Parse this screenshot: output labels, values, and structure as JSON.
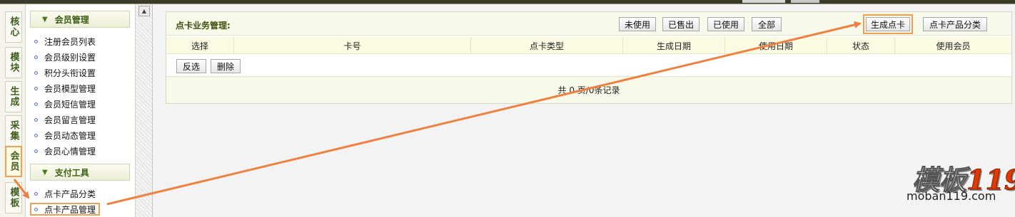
{
  "tabs": [
    {
      "label": "核心",
      "active": false
    },
    {
      "label": "模块",
      "active": false
    },
    {
      "label": "生成",
      "active": false
    },
    {
      "label": "采集",
      "active": false
    },
    {
      "label": "会员",
      "active": true
    },
    {
      "label": "模板",
      "active": false
    }
  ],
  "sidebar": {
    "sections": [
      {
        "title": "会员管理",
        "items": [
          "注册会员列表",
          "会员级别设置",
          "积分头衔设置",
          "会员模型管理",
          "会员短信管理",
          "会员留言管理",
          "会员动态管理",
          "会员心情管理"
        ]
      },
      {
        "title": "支付工具",
        "items": [
          "点卡产品分类",
          "点卡产品管理"
        ]
      }
    ],
    "active_item": "点卡产品管理"
  },
  "panel": {
    "title": "点卡业务管理:",
    "filters": [
      "未使用",
      "已售出",
      "已使用",
      "全部"
    ],
    "generate_label": "生成点卡",
    "category_label": "点卡产品分类",
    "columns": [
      "选择",
      "卡号",
      "点卡类型",
      "生成日期",
      "使用日期",
      "状态",
      "使用会员"
    ],
    "invert_label": "反选",
    "delete_label": "删除",
    "footer": "共 0 页/0条记录"
  },
  "watermark": {
    "logo_text": "模板",
    "logo_num": "119",
    "url": "moban119.com"
  },
  "colors": {
    "accent_orange": "#f0a050",
    "section_green": "#3b5e10",
    "header_bg": "#f7f9ea"
  }
}
